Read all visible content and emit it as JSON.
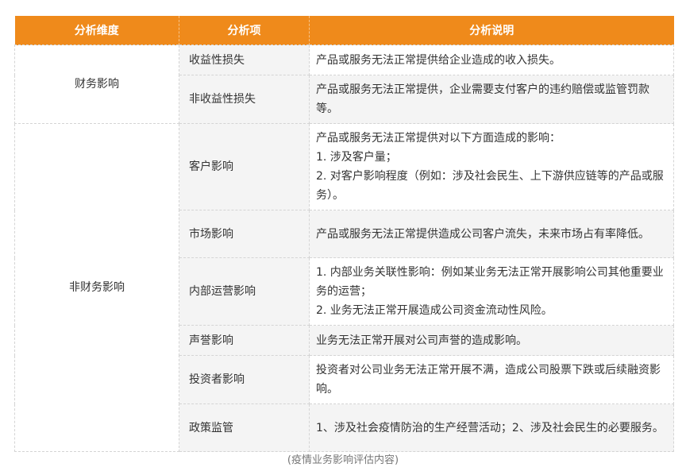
{
  "table": {
    "headers": [
      "分析维度",
      "分析项",
      "分析说明"
    ],
    "groups": [
      {
        "dimension": "财务影响",
        "rows": [
          {
            "item": "收益性损失",
            "desc": [
              "产品或服务无法正常提供给企业造成的收入损失。"
            ]
          },
          {
            "item": "非收益性损失",
            "desc": [
              "产品或服务无法正常提供，企业需要支付客户的违约赔偿或监管罚款等。"
            ]
          }
        ]
      },
      {
        "dimension": "非财务影响",
        "rows": [
          {
            "item": "客户影响",
            "desc": [
              "产品或服务无法正常提供对以下方面造成的影响：",
              "1. 涉及客户量；",
              "2. 对客户影响程度（例如：涉及社会民生、上下游供应链等的产品或服务）。"
            ]
          },
          {
            "item": "市场影响",
            "desc": [
              "产品或服务无法正常提供造成公司客户流失，未来市场占有率降低。"
            ]
          },
          {
            "item": "内部运营影响",
            "desc": [
              "1. 内部业务关联性影响：例如某业务无法正常开展影响公司其他重要业务的运营；",
              "2. 业务无法正常开展造成公司资金流动性风险。"
            ]
          },
          {
            "item": "声誉影响",
            "desc": [
              "业务无法正常开展对公司声誉的造成影响。"
            ]
          },
          {
            "item": "投资者影响",
            "desc": [
              "投资者对公司业务无法正常开展不满，造成公司股票下跌或后续融资影响。"
            ]
          },
          {
            "item": "政策监管",
            "desc": [
              "1、涉及社会疫情防治的生产经营活动；2、涉及社会民生的必要服务。"
            ]
          }
        ]
      }
    ]
  },
  "caption": "(疫情业务影响评估内容)",
  "colors": {
    "header_bg": "#ef8a1b",
    "header_text": "#ffffff",
    "item_bg": "#f4f4f4"
  }
}
